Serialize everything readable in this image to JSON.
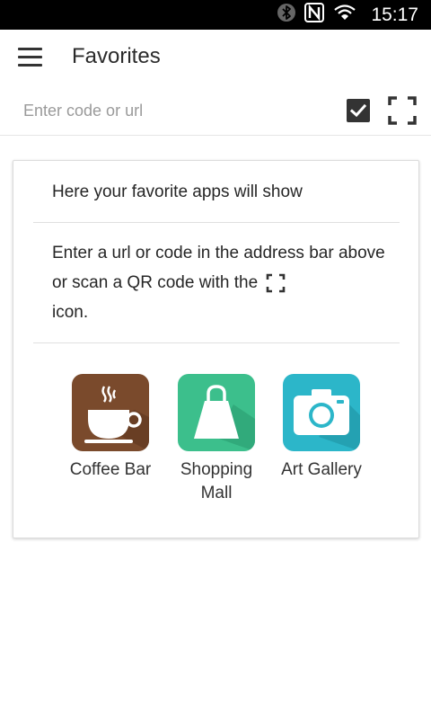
{
  "status_bar": {
    "time": "15:17",
    "icons": [
      "bluetooth-icon",
      "nfc-icon",
      "wifi-icon"
    ]
  },
  "app_bar": {
    "title": "Favorites",
    "menu_icon": "hamburger-menu-icon"
  },
  "address_bar": {
    "placeholder": "Enter code or url",
    "value": "",
    "checkbox_checked": true,
    "scan_icon": "qr-scan-icon"
  },
  "card": {
    "heading": "Here your favorite apps will show",
    "instructions_before_icon": "Enter a url or code in the address bar above or scan a QR code with the",
    "instructions_after_icon": "icon."
  },
  "apps": [
    {
      "label": "Coffee Bar",
      "icon": "coffee-cup-icon",
      "color": "#7a4a2c"
    },
    {
      "label": "Shopping\nMall",
      "icon": "shopping-bag-icon",
      "color": "#3cbf8c"
    },
    {
      "label": "Art Gallery",
      "icon": "camera-icon",
      "color": "#2cb6c9"
    }
  ],
  "colors": {
    "status_bar": "#000000",
    "text_primary": "#262626",
    "text_hint": "#9a9a9a"
  }
}
